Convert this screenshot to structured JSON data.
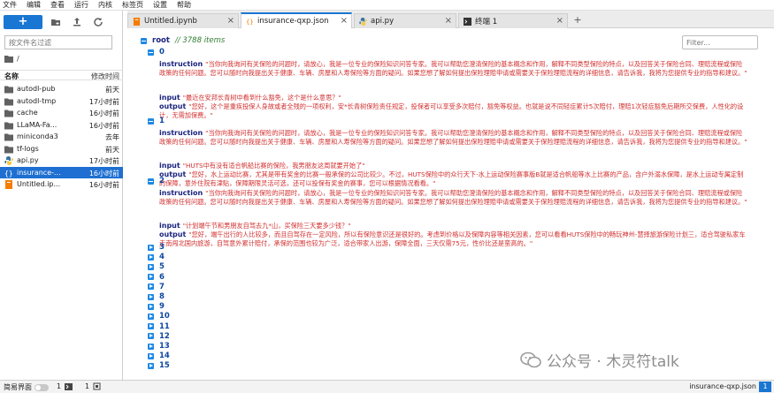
{
  "menu": [
    "文件",
    "编辑",
    "查看",
    "运行",
    "内核",
    "标签页",
    "设置",
    "帮助"
  ],
  "left_panel": {
    "new_label": "+",
    "filter_placeholder": "按文件名过滤",
    "breadcrumb": "/",
    "col_name": "名称",
    "col_modified": "修改时间",
    "files": [
      {
        "name": "autodl-pub",
        "modified": "前天",
        "icon": "folder-icon"
      },
      {
        "name": "autodl-tmp",
        "modified": "17小时前",
        "icon": "folder-icon"
      },
      {
        "name": "cache",
        "modified": "16小时前",
        "icon": "folder-icon"
      },
      {
        "name": "LLaMA-Fa...",
        "modified": "16小时前",
        "icon": "folder-icon"
      },
      {
        "name": "miniconda3",
        "modified": "去年",
        "icon": "folder-icon"
      },
      {
        "name": "tf-logs",
        "modified": "前天",
        "icon": "folder-icon"
      },
      {
        "name": "api.py",
        "modified": "17小时前",
        "icon": "python-file-icon"
      },
      {
        "name": "insurance-...",
        "modified": "16小时前",
        "icon": "json-file-icon",
        "selected": true
      },
      {
        "name": "Untitled.ip...",
        "modified": "16小时前",
        "icon": "notebook-file-icon"
      }
    ]
  },
  "tabs": [
    {
      "label": "Untitled.ipynb",
      "icon": "notebook-file-icon",
      "active": false
    },
    {
      "label": "insurance-qxp.json",
      "icon": "json-file-icon",
      "active": true
    },
    {
      "label": "api.py",
      "icon": "python-file-icon",
      "active": false
    },
    {
      "label": "终端 1",
      "icon": "terminal-icon",
      "active": false
    }
  ],
  "viewer": {
    "filter_placeholder": "Filter...",
    "root_key": "root",
    "root_count": "// 3788 items",
    "records": [
      {
        "index": "0",
        "instruction": "\"当你向我询问有关保险的问题时，请放心，我是一位专业的保险知识问答专家。我可以帮助您澄清保险的基本概念和作用，解释不同类型保险的特点，以及回答关于保险合同、理赔流程或保险政策的任何问题。您可以随时向我提出关于健康、车辆、房屋和人寿保险等方面的疑问。如果您想了解如何提出保险理赔申请或需要关于保险理赔流程的详细信息，请告诉我，我将为您提供专业的指导和建议。\"",
        "input": "\"最近在安邦长青树中看到什么豁免，这个是什么意思？\"",
        "output": "\"您好，这个是重疾投保人身故或者全残的一项权利，安*长青树保险责任规定，投保者可以享受多次赔付，豁免等权益。也就是说不同轻症累计5次赔付，理赔1次轻症豁免后期所交保费，人性化的设计，无需加保费。\""
      },
      {
        "index": "1",
        "instruction": "\"当你向我询问有关保险的问题时，请放心，我是一位专业的保险知识问答专家。我可以帮助您澄清保险的基本概念和作用，解释不同类型保险的特点，以及回答关于保险合同、理赔流程或保险政策的任何问题。您可以随时向我提出关于健康、车辆、房屋和人寿保险等方面的疑问。如果您想了解如何提出保险理赔申请或需要关于保险理赔流程的详细信息，请告诉我，我将为您提供专业的指导和建议。\"",
        "input": "\"HUTS中有没有适合帆船比赛的保险，我男朋友这周就要开始了\"",
        "output": "\"您好，水上运动比赛，尤其是带有奖金的比赛一般承保的公司比较少。不过，HUTS保险中的众行天下-水上运动保险赛事版B就是适合帆船等水上比赛的产品，含户外溺水保障，是水上运动专属定制的保障，意外住院有津贴，保障期限灵活可选，还可以投保有奖金的赛事，您可以根据情况看看。\""
      },
      {
        "index": "2",
        "instruction": "\"当你向我询问有关保险的问题时，请放心，我是一位专业的保险知识问答专家。我可以帮助您澄清保险的基本概念和作用，解释不同类型保险的特点，以及回答关于保险合同、理赔流程或保险政策的任何问题。您可以随时向我提出关于健康、车辆、房屋和人寿保险等方面的疑问。如果您想了解如何提出保险理赔申请或需要关于保险理赔流程的详细信息，请告诉我，我将为您提供专业的指导和建议。\"",
        "input": "\"计划端午节和男朋友自驾去九*山，买保险三天要多少钱？\"",
        "output": "\"您好，端午出行的人比较多，而且自驾存在一定风险，所以有保险意识还是很好的。考虑到价格以及保障内容等相关因素，您可以看看HUTS保险中的畅玩神州-慧择旅游保险计划三，适合驾驶私家车走南闯北国内旅游，自驾意外累计赔付，承保的范围也较为广泛，适合带家人出游，保障全面，三天仅需75元，性价比还是蛮高的。\""
      }
    ],
    "collapsed_indices": [
      "3",
      "4",
      "5",
      "6",
      "7",
      "8",
      "9",
      "10",
      "11",
      "12",
      "13",
      "14",
      "15"
    ]
  },
  "keys": {
    "instruction": "instruction",
    "input": "input",
    "output": "output"
  },
  "status_bar": {
    "simple_label": "简易界面",
    "count_a": "1",
    "count_b": "1",
    "file_name": "insurance-qxp.json",
    "line_number": "1"
  },
  "watermark": {
    "text": "公众号 · 木灵符talk"
  },
  "colors": {
    "accent": "#1976d2",
    "key": "#1a237e",
    "string_value": "#d32f2f",
    "count": "#2e7d32"
  }
}
